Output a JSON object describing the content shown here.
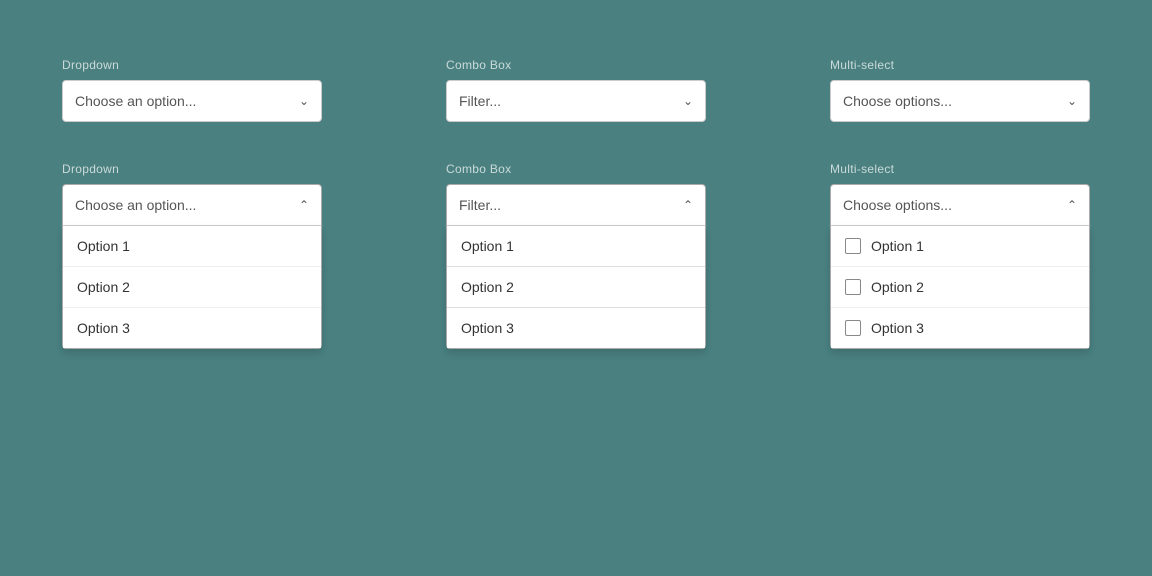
{
  "panels": [
    {
      "id": "dropdown",
      "closed": {
        "label": "Dropdown",
        "placeholder": "Choose an option..."
      },
      "open": {
        "label": "Dropdown",
        "placeholder": "Choose an option...",
        "options": [
          "Option 1",
          "Option 2",
          "Option 3"
        ]
      }
    },
    {
      "id": "combo-box",
      "closed": {
        "label": "Combo Box",
        "placeholder": "Filter..."
      },
      "open": {
        "label": "Combo Box",
        "placeholder": "Filter...",
        "options": [
          "Option 1",
          "Option 2",
          "Option 3"
        ]
      }
    },
    {
      "id": "multi-select",
      "closed": {
        "label": "Multi-select",
        "placeholder": "Choose options..."
      },
      "open": {
        "label": "Multi-select",
        "placeholder": "Choose options...",
        "options": [
          "Option 1",
          "Option 2",
          "Option 3"
        ]
      }
    }
  ]
}
